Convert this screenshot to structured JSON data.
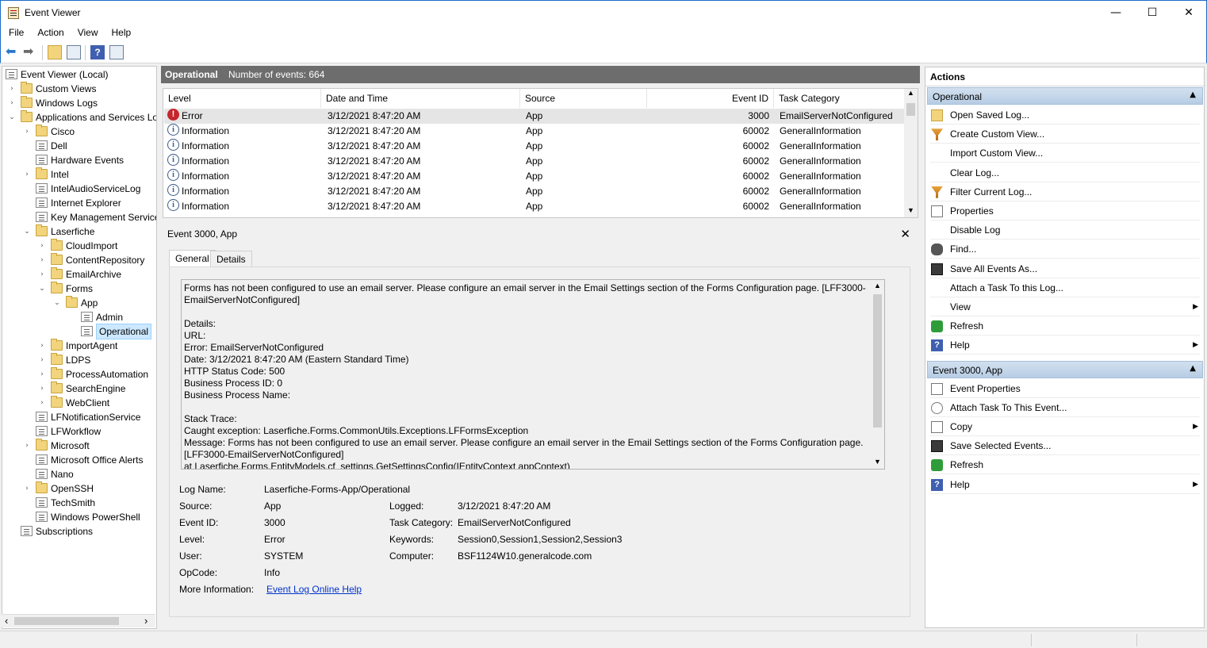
{
  "window": {
    "title": "Event Viewer",
    "minimize": "—",
    "maximize": "☐",
    "close": "✕"
  },
  "menu": [
    "File",
    "Action",
    "View",
    "Help"
  ],
  "tree": {
    "items": [
      {
        "label": "Event Viewer (Local)",
        "level": 0,
        "expander": "",
        "icon": "log-icon"
      },
      {
        "label": "Custom Views",
        "level": 1,
        "expander": "›",
        "icon": "folder-icon"
      },
      {
        "label": "Windows Logs",
        "level": 1,
        "expander": "›",
        "icon": "folder-icon"
      },
      {
        "label": "Applications and Services Lo",
        "level": 1,
        "expander": "⌄",
        "icon": "folder-icon"
      },
      {
        "label": "Cisco",
        "level": 2,
        "expander": "›",
        "icon": "folder-icon"
      },
      {
        "label": "Dell",
        "level": 2,
        "expander": "",
        "icon": "log-icon"
      },
      {
        "label": "Hardware Events",
        "level": 2,
        "expander": "",
        "icon": "log-icon"
      },
      {
        "label": "Intel",
        "level": 2,
        "expander": "›",
        "icon": "folder-icon"
      },
      {
        "label": "IntelAudioServiceLog",
        "level": 2,
        "expander": "",
        "icon": "log-icon"
      },
      {
        "label": "Internet Explorer",
        "level": 2,
        "expander": "",
        "icon": "log-icon"
      },
      {
        "label": "Key Management Service",
        "level": 2,
        "expander": "",
        "icon": "log-icon"
      },
      {
        "label": "Laserfiche",
        "level": 2,
        "expander": "⌄",
        "icon": "folder-icon"
      },
      {
        "label": "CloudImport",
        "level": 3,
        "expander": "›",
        "icon": "folder-icon"
      },
      {
        "label": "ContentRepository",
        "level": 3,
        "expander": "›",
        "icon": "folder-icon"
      },
      {
        "label": "EmailArchive",
        "level": 3,
        "expander": "›",
        "icon": "folder-icon"
      },
      {
        "label": "Forms",
        "level": 3,
        "expander": "⌄",
        "icon": "folder-icon"
      },
      {
        "label": "App",
        "level": 4,
        "expander": "⌄",
        "icon": "folder-icon"
      },
      {
        "label": "Admin",
        "level": 5,
        "expander": "",
        "icon": "log-icon"
      },
      {
        "label": "Operational",
        "level": 5,
        "expander": "",
        "icon": "log-icon",
        "selected": true
      },
      {
        "label": "ImportAgent",
        "level": 3,
        "expander": "›",
        "icon": "folder-icon"
      },
      {
        "label": "LDPS",
        "level": 3,
        "expander": "›",
        "icon": "folder-icon"
      },
      {
        "label": "ProcessAutomation",
        "level": 3,
        "expander": "›",
        "icon": "folder-icon"
      },
      {
        "label": "SearchEngine",
        "level": 3,
        "expander": "›",
        "icon": "folder-icon"
      },
      {
        "label": "WebClient",
        "level": 3,
        "expander": "›",
        "icon": "folder-icon"
      },
      {
        "label": "LFNotificationService",
        "level": 2,
        "expander": "",
        "icon": "log-icon"
      },
      {
        "label": "LFWorkflow",
        "level": 2,
        "expander": "",
        "icon": "log-icon"
      },
      {
        "label": "Microsoft",
        "level": 2,
        "expander": "›",
        "icon": "folder-icon"
      },
      {
        "label": "Microsoft Office Alerts",
        "level": 2,
        "expander": "",
        "icon": "log-icon"
      },
      {
        "label": "Nano",
        "level": 2,
        "expander": "",
        "icon": "log-icon"
      },
      {
        "label": "OpenSSH",
        "level": 2,
        "expander": "›",
        "icon": "folder-icon"
      },
      {
        "label": "TechSmith",
        "level": 2,
        "expander": "",
        "icon": "log-icon"
      },
      {
        "label": "Windows PowerShell",
        "level": 2,
        "expander": "",
        "icon": "log-icon"
      },
      {
        "label": "Subscriptions",
        "level": 1,
        "expander": "",
        "icon": "log-icon"
      }
    ],
    "scroll_left": "‹",
    "scroll_right": "›"
  },
  "center": {
    "title": "Operational",
    "count_text": "Number of events: 664",
    "columns": [
      "Level",
      "Date and Time",
      "Source",
      "Event ID",
      "Task Category"
    ],
    "rows": [
      {
        "level": "Error",
        "date": "3/12/2021 8:47:20 AM",
        "source": "App",
        "id": "3000",
        "category": "EmailServerNotConfigured",
        "selected": true
      },
      {
        "level": "Information",
        "date": "3/12/2021 8:47:20 AM",
        "source": "App",
        "id": "60002",
        "category": "GeneralInformation"
      },
      {
        "level": "Information",
        "date": "3/12/2021 8:47:20 AM",
        "source": "App",
        "id": "60002",
        "category": "GeneralInformation"
      },
      {
        "level": "Information",
        "date": "3/12/2021 8:47:20 AM",
        "source": "App",
        "id": "60002",
        "category": "GeneralInformation"
      },
      {
        "level": "Information",
        "date": "3/12/2021 8:47:20 AM",
        "source": "App",
        "id": "60002",
        "category": "GeneralInformation"
      },
      {
        "level": "Information",
        "date": "3/12/2021 8:47:20 AM",
        "source": "App",
        "id": "60002",
        "category": "GeneralInformation"
      },
      {
        "level": "Information",
        "date": "3/12/2021 8:47:20 AM",
        "source": "App",
        "id": "60002",
        "category": "GeneralInformation"
      }
    ]
  },
  "detail": {
    "title": "Event 3000, App",
    "close": "✕",
    "tabs": [
      "General",
      "Details"
    ],
    "description_lines": [
      "Forms has not been configured to use an email server. Please configure an email server in the Email Settings section of the Forms Configuration page. [LFF3000-",
      "EmailServerNotConfigured]",
      "",
      "Details:",
      "URL:",
      "Error: EmailServerNotConfigured",
      "Date: 3/12/2021 8:47:20 AM (Eastern Standard Time)",
      "HTTP Status Code: 500",
      "Business Process ID: 0",
      "Business Process Name:",
      "",
      "Stack Trace:",
      "Caught exception: Laserfiche.Forms.CommonUtils.Exceptions.LFFormsException",
      "Message: Forms has not been configured to use an email server. Please configure an email server in the Email Settings section of the Forms Configuration page.",
      "[LFF3000-EmailServerNotConfigured]",
      "   at Laserfiche.Forms.EntityModels.cf_settings.GetSettingsConfig(IEntityContext appContext)"
    ],
    "fields": {
      "log_name_label": "Log Name:",
      "log_name": "Laserfiche-Forms-App/Operational",
      "source_label": "Source:",
      "source": "App",
      "logged_label": "Logged:",
      "logged": "3/12/2021 8:47:20 AM",
      "event_id_label": "Event ID:",
      "event_id": "3000",
      "task_category_label": "Task Category:",
      "task_category": "EmailServerNotConfigured",
      "level_label": "Level:",
      "level": "Error",
      "keywords_label": "Keywords:",
      "keywords": "Session0,Session1,Session2,Session3",
      "user_label": "User:",
      "user": "SYSTEM",
      "computer_label": "Computer:",
      "computer": "BSF1124W10.generalcode.com",
      "opcode_label": "OpCode:",
      "opcode": "Info",
      "more_info_label": "More Information:",
      "more_info_link": "Event Log Online Help"
    }
  },
  "actions": {
    "title": "Actions",
    "sections": [
      {
        "title": "Operational",
        "items": [
          {
            "label": "Open Saved Log...",
            "icon": "open-folder-icon",
            "submenu": false
          },
          {
            "label": "Create Custom View...",
            "icon": "filter-icon",
            "submenu": false
          },
          {
            "label": "Import Custom View...",
            "icon": "",
            "submenu": false
          },
          {
            "label": "Clear Log...",
            "icon": "",
            "submenu": false
          },
          {
            "label": "Filter Current Log...",
            "icon": "filter-icon",
            "submenu": false
          },
          {
            "label": "Properties",
            "icon": "properties-icon",
            "submenu": false
          },
          {
            "label": "Disable Log",
            "icon": "",
            "submenu": false
          },
          {
            "label": "Find...",
            "icon": "binoculars-icon",
            "submenu": false
          },
          {
            "label": "Save All Events As...",
            "icon": "save-icon",
            "submenu": false
          },
          {
            "label": "Attach a Task To this Log...",
            "icon": "",
            "submenu": false
          },
          {
            "label": "View",
            "icon": "",
            "submenu": true
          },
          {
            "label": "Refresh",
            "icon": "refresh-icon",
            "submenu": false
          },
          {
            "label": "Help",
            "icon": "help-icon",
            "submenu": true
          }
        ]
      },
      {
        "title": "Event 3000, App",
        "items": [
          {
            "label": "Event Properties",
            "icon": "properties-icon",
            "submenu": false
          },
          {
            "label": "Attach Task To This Event...",
            "icon": "task-icon",
            "submenu": false
          },
          {
            "label": "Copy",
            "icon": "copy-icon",
            "submenu": true
          },
          {
            "label": "Save Selected Events...",
            "icon": "save-icon",
            "submenu": false
          },
          {
            "label": "Refresh",
            "icon": "refresh-icon",
            "submenu": false
          },
          {
            "label": "Help",
            "icon": "help-icon",
            "submenu": true
          }
        ]
      }
    ]
  },
  "colors": {
    "accent": "#1b6ac9",
    "header_gray": "#6d6d6d",
    "section_blue": "#c3d6ea",
    "selection": "#cce8ff",
    "link": "#0033cc",
    "error_red": "#c4262e"
  }
}
